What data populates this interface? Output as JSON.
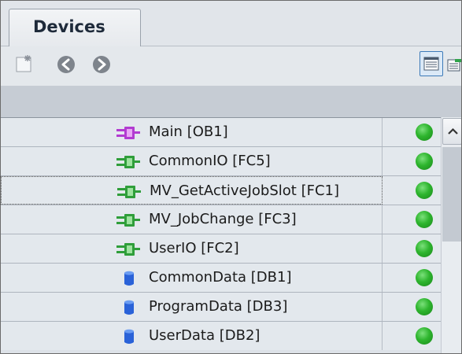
{
  "tab": {
    "label": "Devices"
  },
  "toolbar": {
    "add_icon": "add-new-icon",
    "back_icon": "back-arrow-icon",
    "forward_icon": "forward-arrow-icon",
    "view_icon": "detail-view-icon",
    "export_icon": "export-icon"
  },
  "colors": {
    "status_ok": "#2eb52e",
    "block_fc": "#2f9e3a",
    "block_ob": "#b23bd1",
    "block_db": "#2a62d8"
  },
  "rows": [
    {
      "label": "Main [OB1]",
      "icon": "ob-block-icon",
      "status": "ok"
    },
    {
      "label": "CommonIO [FC5]",
      "icon": "fc-block-icon",
      "status": "ok"
    },
    {
      "label": "MV_GetActiveJobSlot [FC1]",
      "icon": "fc-block-icon",
      "status": "ok"
    },
    {
      "label": "MV_JobChange [FC3]",
      "icon": "fc-block-icon",
      "status": "ok"
    },
    {
      "label": "UserIO [FC2]",
      "icon": "fc-block-icon",
      "status": "ok"
    },
    {
      "label": "CommonData [DB1]",
      "icon": "db-block-icon",
      "status": "ok"
    },
    {
      "label": "ProgramData [DB3]",
      "icon": "db-block-icon",
      "status": "ok"
    },
    {
      "label": "UserData [DB2]",
      "icon": "db-block-icon",
      "status": "ok"
    }
  ]
}
